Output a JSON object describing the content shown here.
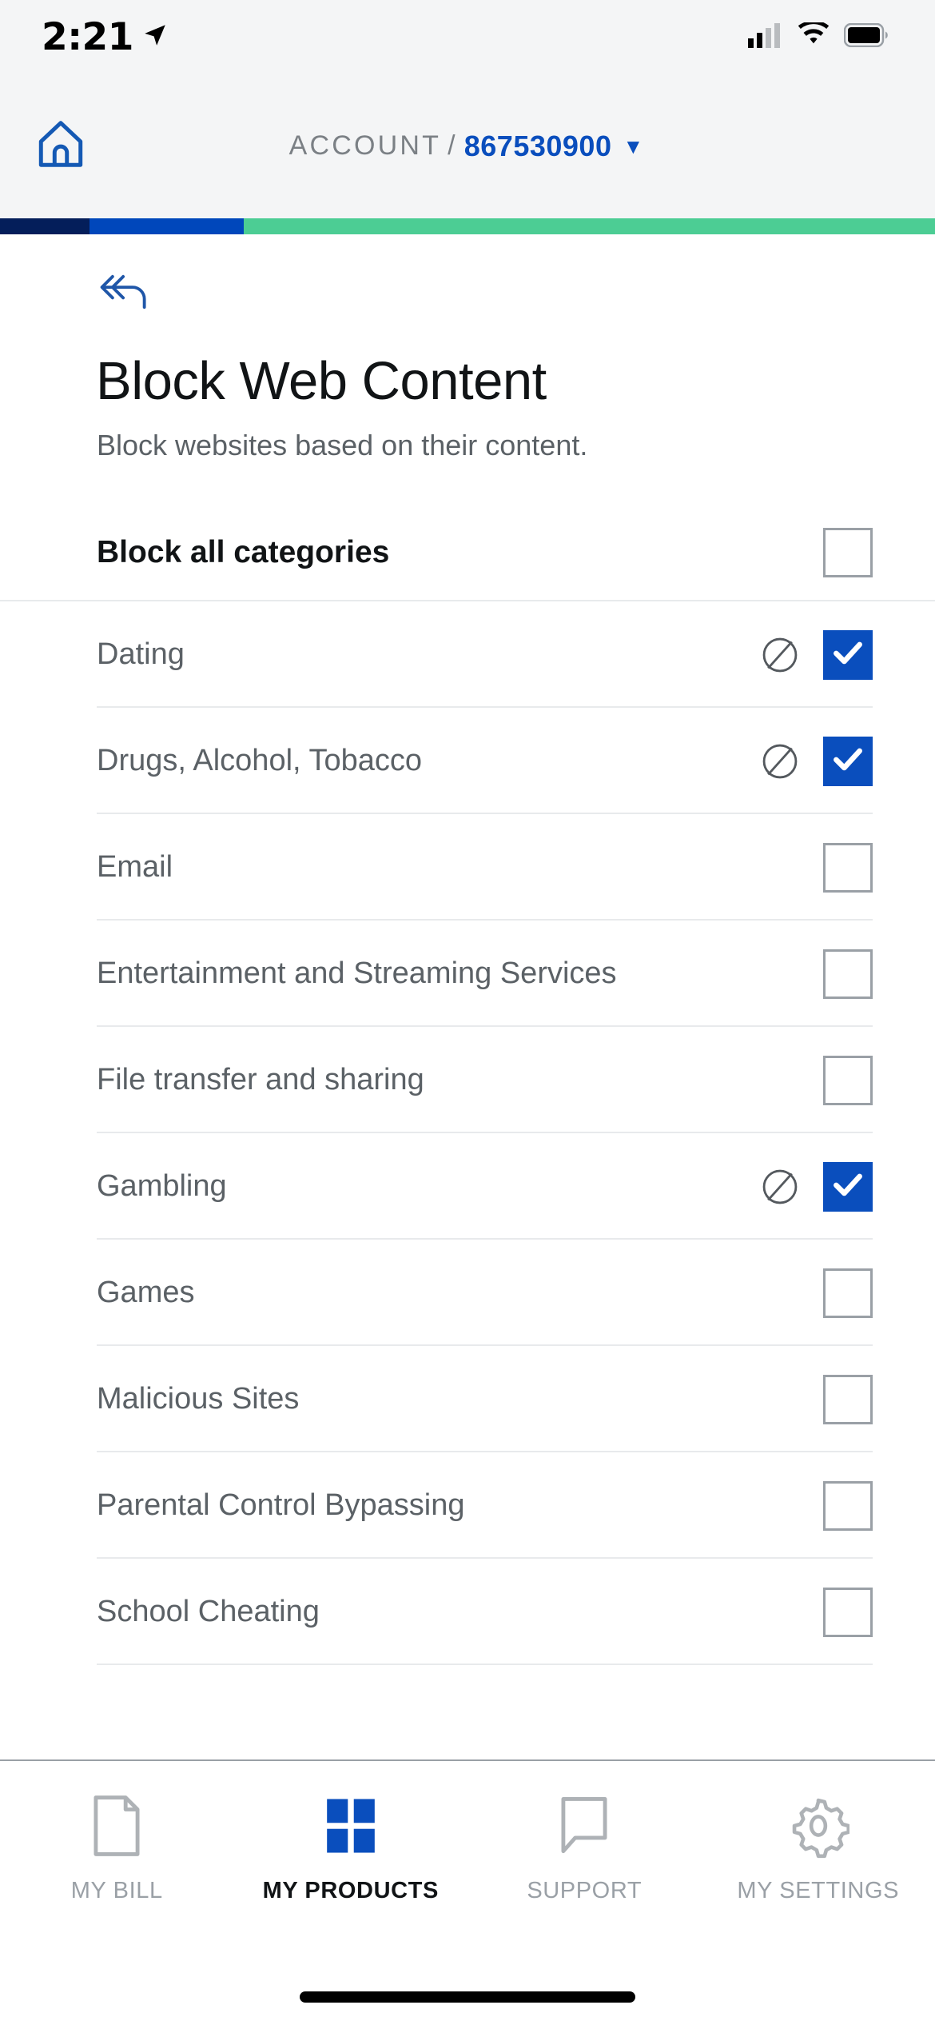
{
  "status_bar": {
    "time": "2:21",
    "location_icon": "location-arrow-icon",
    "signal_icon": "cellular-signal-icon",
    "wifi_icon": "wifi-icon",
    "battery_icon": "battery-icon"
  },
  "header": {
    "home_icon": "home-icon",
    "account_label": "ACCOUNT",
    "separator": "/",
    "account_number": "867530900",
    "caret": "▼",
    "brand_bar_colors": [
      "#041E5A",
      "#0047BB",
      "#4CCD94"
    ]
  },
  "page": {
    "back_icon": "back-double-chevron-icon",
    "title": "Block Web Content",
    "subtitle": "Block websites based on their content.",
    "block_all": {
      "label": "Block all categories",
      "checked": false
    }
  },
  "categories": [
    {
      "label": "Dating",
      "blocked_icon": true,
      "checked": true
    },
    {
      "label": "Drugs, Alcohol, Tobacco",
      "blocked_icon": true,
      "checked": true
    },
    {
      "label": "Email",
      "blocked_icon": false,
      "checked": false
    },
    {
      "label": "Entertainment and Streaming Services",
      "blocked_icon": false,
      "checked": false
    },
    {
      "label": "File transfer and sharing",
      "blocked_icon": false,
      "checked": false
    },
    {
      "label": "Gambling",
      "blocked_icon": true,
      "checked": true
    },
    {
      "label": "Games",
      "blocked_icon": false,
      "checked": false
    },
    {
      "label": "Malicious Sites",
      "blocked_icon": false,
      "checked": false
    },
    {
      "label": "Parental Control Bypassing",
      "blocked_icon": false,
      "checked": false
    },
    {
      "label": "School Cheating",
      "blocked_icon": false,
      "checked": false
    }
  ],
  "tabbar": {
    "items": [
      {
        "label": "MY BILL",
        "icon": "document-icon",
        "active": false
      },
      {
        "label": "MY PRODUCTS",
        "icon": "grid-squares-icon",
        "active": true
      },
      {
        "label": "SUPPORT",
        "icon": "speech-bubble-icon",
        "active": false
      },
      {
        "label": "MY SETTINGS",
        "icon": "gear-icon",
        "active": false
      }
    ]
  },
  "colors": {
    "accent_blue": "#0A4EBD",
    "brand_navy": "#041E5A",
    "brand_blue": "#0047BB",
    "brand_green": "#4CCD94",
    "text_muted": "#5B6166",
    "divider": "#E8EAEC"
  }
}
